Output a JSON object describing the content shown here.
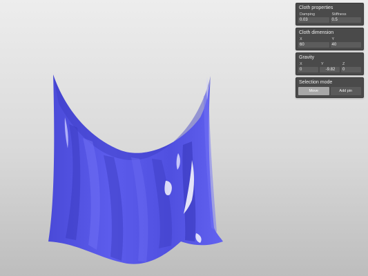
{
  "colors": {
    "cloth": "#5a5ae8",
    "cloth_shadow": "#3a3ac0",
    "cloth_highlight": "#ffffff",
    "panel_bg": "#4a4a4a",
    "field_bg": "#5c5c5c",
    "button_active": "#a8a8a8"
  },
  "panels": {
    "cloth_properties": {
      "title": "Cloth properties",
      "damping_label": "Damping",
      "damping_value": "0.03",
      "stiffness_label": "Stiffness",
      "stiffness_value": "0.5"
    },
    "cloth_dimension": {
      "title": "Cloth dimension",
      "x_label": "X",
      "x_value": "60",
      "y_label": "Y",
      "y_value": "40"
    },
    "gravity": {
      "title": "Gravity",
      "x_label": "X",
      "x_value": "0",
      "y_label": "Y",
      "y_value": "-9.82",
      "z_label": "Z",
      "z_value": "0"
    },
    "selection_mode": {
      "title": "Selection mode",
      "move_label": "Move",
      "add_pin_label": "Add pin",
      "active": "Move"
    }
  }
}
